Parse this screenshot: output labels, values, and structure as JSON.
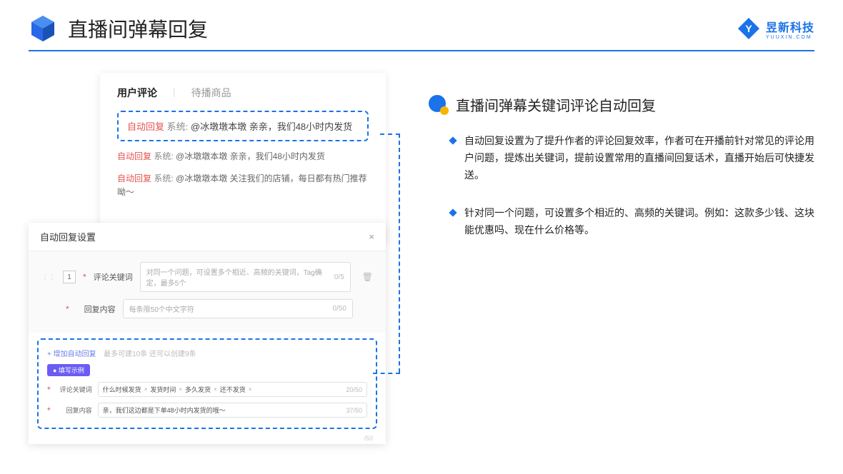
{
  "header": {
    "title": "直播间弹幕回复",
    "logo_text": "昱新科技",
    "logo_sub": "YUUXIN.COM"
  },
  "comments_panel": {
    "tab1": "用户评论",
    "tab2": "待播商品",
    "highlight_auto": "自动回复",
    "highlight_sys": "系统:",
    "highlight_text": "@冰墩墩本墩 亲亲，我们48小时内发货",
    "line2_auto": "自动回复",
    "line2_sys": "系统:",
    "line2_text": "@冰墩墩本墩 亲亲，我们48小时内发货",
    "line3_auto": "自动回复",
    "line3_sys": "系统:",
    "line3_text": "@冰墩墩本墩 关注我们的店铺，每日都有热门推荐呦～"
  },
  "settings_panel": {
    "title": "自动回复设置",
    "row_num": "1",
    "label_keyword": "评论关键词",
    "placeholder_keyword": "对同一个问题，可设置多个相近、高频的关键词，Tag确定，最多5个",
    "counter_keyword": "0/5",
    "label_content": "回复内容",
    "placeholder_content": "每条限50个中文字符",
    "counter_content": "0/50",
    "add_link": "+ 增加自动回复",
    "add_hint": "最多可建10条 还可以创建9条",
    "badge": "● 填写示例",
    "example_label_kw": "评论关键词",
    "example_tags": [
      "什么时候发货",
      "发货时间",
      "多久发货",
      "还不发货"
    ],
    "example_kw_counter": "20/50",
    "example_label_content": "回复内容",
    "example_content": "亲，我们这边都是下单48小时内发货的哦～",
    "example_content_counter": "37/50",
    "bottom_counter": "/50"
  },
  "right": {
    "title": "直播间弹幕关键词评论自动回复",
    "bullet1": "自动回复设置为了提升作者的评论回复效率，作者可在开播前针对常见的评论用户问题，提炼出关键词，提前设置常用的直播间回复话术，直播开始后可快捷发送。",
    "bullet2": "针对同一个问题，可设置多个相近的、高频的关键词。例如：这款多少钱、这块能优惠吗、现在什么价格等。"
  }
}
